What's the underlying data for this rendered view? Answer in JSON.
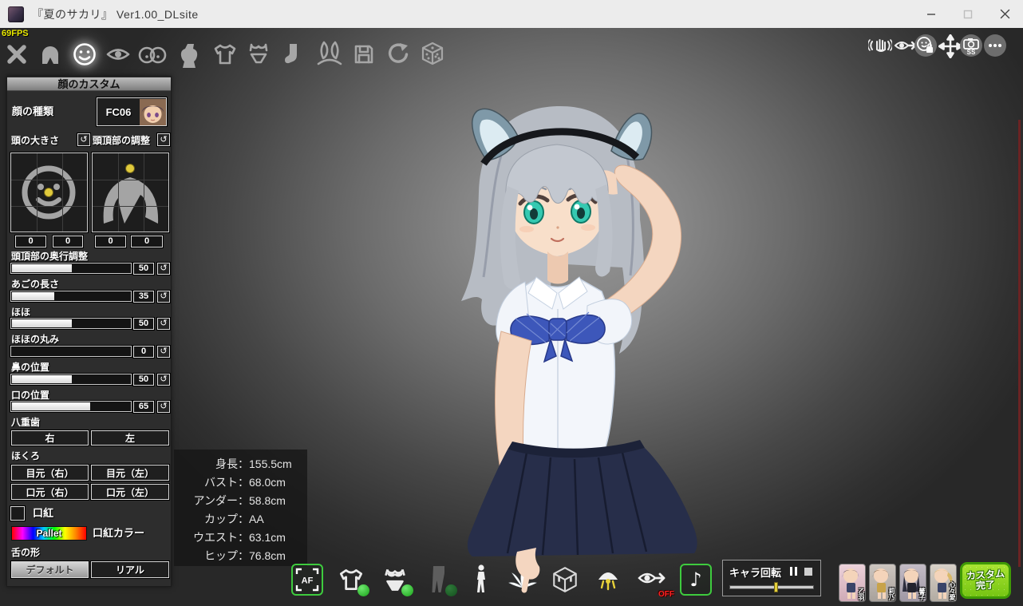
{
  "window": {
    "title": "『夏のサカリ』 Ver1.00_DLsite",
    "controls": [
      "minimize",
      "maximize",
      "close"
    ]
  },
  "hud": {
    "fps": "69FPS"
  },
  "top_toolbar": {
    "icons": [
      "close",
      "hair",
      "face",
      "eyes",
      "chest",
      "body",
      "clothes-top",
      "underwear",
      "legwear",
      "accessory",
      "save",
      "undo",
      "random"
    ],
    "selected": "face"
  },
  "top_right_toolbar": {
    "icons": [
      "haptic-hand",
      "gaze-toggle",
      "expression-lock",
      "move-camera",
      "screenshot",
      "more"
    ],
    "screenshot_label": "SS"
  },
  "sidebar": {
    "title": "顔のカスタム",
    "face_type": {
      "label": "顔の種類",
      "value": "FC06"
    },
    "pads": {
      "head_size": {
        "label": "頭の大きさ",
        "x": "0",
        "y": "0"
      },
      "head_top": {
        "label": "頭頂部の調整",
        "x": "0",
        "y": "0"
      }
    },
    "sliders": [
      {
        "label": "頭頂部の奥行調整",
        "value": "50",
        "percent": 50
      },
      {
        "label": "あごの長さ",
        "value": "35",
        "percent": 35
      },
      {
        "label": "ほほ",
        "value": "50",
        "percent": 50
      },
      {
        "label": "ほほの丸み",
        "value": "0",
        "percent": 0
      },
      {
        "label": "鼻の位置",
        "value": "50",
        "percent": 50
      },
      {
        "label": "口の位置",
        "value": "65",
        "percent": 65
      }
    ],
    "yaeba": {
      "label": "八重歯",
      "buttons": [
        "右",
        "左"
      ]
    },
    "hokuro": {
      "label": "ほくろ",
      "buttons": [
        "目元（右）",
        "目元（左）",
        "口元（右）",
        "口元（左）"
      ]
    },
    "lipstick": {
      "label": "口紅",
      "checked": false
    },
    "lip_color": {
      "button": "Pallet",
      "label": "口紅カラー"
    },
    "tongue": {
      "label": "舌の形",
      "options": [
        "デフォルト",
        "リアル"
      ],
      "selected": "デフォルト"
    }
  },
  "stats": {
    "colon": "：",
    "rows": [
      {
        "label": "身長",
        "value": "155.5cm"
      },
      {
        "label": "バスト",
        "value": "68.0cm"
      },
      {
        "label": "アンダー",
        "value": "58.8cm"
      },
      {
        "label": "カップ",
        "value": "AA"
      },
      {
        "label": "ウエスト",
        "value": "63.1cm"
      },
      {
        "label": "ヒップ",
        "value": "76.8cm"
      }
    ]
  },
  "bottom_toolbar": {
    "autofocus_label": "AF",
    "icons": [
      "autofocus",
      "clothes-top",
      "underwear",
      "legwear",
      "pose",
      "splash",
      "cube",
      "light",
      "gaze-off",
      "music"
    ],
    "toggles": {
      "clothes_top": "on",
      "underwear": "on",
      "legwear": "off"
    },
    "gaze_off_label": "OFF",
    "rotation": {
      "label": "キャラ回転",
      "position_percent": 55
    }
  },
  "character_tabs": [
    {
      "name": "乙羽"
    },
    {
      "name": "莉乃"
    },
    {
      "name": "馨子"
    },
    {
      "name": "心々愛"
    }
  ],
  "finish_button": {
    "line1": "カスタム",
    "line2": "完了"
  },
  "colors": {
    "accent_green": "#3ecb3e",
    "badge_on": "#2ecc40",
    "badge_off": "#1d6b2a",
    "fps_yellow": "#e8e800",
    "slider_handle": "#e3cf3a",
    "scroll_strip": "#6b2323"
  }
}
